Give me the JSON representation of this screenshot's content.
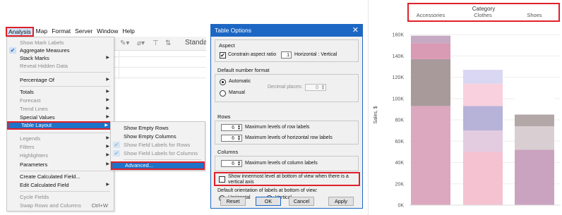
{
  "menubar": [
    "Analysis",
    "Map",
    "Format",
    "Server",
    "Window",
    "Help"
  ],
  "toolbar": {
    "standard_label": "Standa"
  },
  "analysis_menu": [
    {
      "label": "Show Mark Labels",
      "disabled": true
    },
    {
      "label": "Aggregate Measures",
      "checked": true
    },
    {
      "label": "Stack Marks",
      "submenu": true
    },
    {
      "label": "Reveal Hidden Data",
      "disabled": true
    },
    {
      "label": "Percentage Of",
      "submenu": true
    },
    {
      "label": "Totals",
      "submenu": true
    },
    {
      "label": "Forecast",
      "submenu": true,
      "disabled": true
    },
    {
      "label": "Trend Lines",
      "submenu": true,
      "disabled": true
    },
    {
      "label": "Special Values",
      "submenu": true
    },
    {
      "label": "Table Layout",
      "submenu": true,
      "highlighted": true
    },
    {
      "label": "Legends",
      "submenu": true,
      "disabled": true
    },
    {
      "label": "Filters",
      "submenu": true,
      "disabled": true
    },
    {
      "label": "Highlighters",
      "submenu": true,
      "disabled": true
    },
    {
      "label": "Parameters",
      "submenu": true
    },
    {
      "label": "Create Calculated Field..."
    },
    {
      "label": "Edit Calculated Field",
      "submenu": true
    },
    {
      "label": "Cycle Fields",
      "disabled": true
    },
    {
      "label": "Swap Rows and Columns",
      "shortcut": "Ctrl+W",
      "disabled": true
    }
  ],
  "table_layout_submenu": [
    {
      "label": "Show Empty Rows"
    },
    {
      "label": "Show Empty Columns"
    },
    {
      "label": "Show Field Labels for Rows",
      "checked": true,
      "disabled": true
    },
    {
      "label": "Show Field Labels for Columns",
      "checked": true,
      "disabled": true
    },
    {
      "label": "Advanced...",
      "highlighted": true
    }
  ],
  "dialog": {
    "title": "Table Options",
    "close_icon": "✕",
    "aspect": {
      "label": "Aspect",
      "constrain_label": "Constrain aspect ratio",
      "constrain_checked": true,
      "ratio": "1",
      "ratio_suffix": "Horizontal : Vertical"
    },
    "number_format": {
      "label": "Default number format",
      "automatic": "Automatic",
      "manual": "Manual",
      "decimal_label": "Decimal places:",
      "decimal_value": "0"
    },
    "rows": {
      "label": "Rows",
      "row_labels_value": "6",
      "row_labels_text": "Maximum levels of row labels",
      "hrow_labels_value": "6",
      "hrow_labels_text": "Maximum levels of horizontal row labels"
    },
    "columns": {
      "label": "Columns",
      "col_labels_value": "6",
      "col_labels_text": "Maximum levels of column labels",
      "innermost_text_1": "Show innermost level at bottom of view when there is a",
      "innermost_text_2": "vertical axis",
      "innermost_checked": false
    },
    "orientation": {
      "label": "Default orientation of labels at bottom of view:",
      "horizontal": "Horizontal",
      "vertical": "Vertical",
      "selected": "Horizontal"
    },
    "buttons": {
      "reset": "Reset",
      "ok": "OK",
      "cancel": "Cancel",
      "apply": "Apply"
    }
  },
  "chart_data": {
    "type": "bar",
    "stacked": true,
    "header_title": "Category",
    "categories": [
      "Accessories",
      "Clothes",
      "Shoes"
    ],
    "ylabel": "Sales, $",
    "ylim": [
      0,
      170000
    ],
    "yticks": [
      "0K",
      "20K",
      "40K",
      "60K",
      "80K",
      "100K",
      "120K",
      "140K",
      "160K"
    ],
    "grid": true,
    "series": [
      {
        "color": "#d8a4bc",
        "values": [
          93000,
          50000,
          52000
        ]
      },
      {
        "color": "#a79b9c",
        "values": [
          44000,
          20000,
          22000
        ]
      },
      {
        "color": "#d89ab2",
        "values": [
          15000,
          23000,
          11000
        ]
      },
      {
        "color": "#c8b0c0",
        "values": [
          7000,
          21000,
          21000
        ]
      },
      {
        "color": "#d9d7f2",
        "values": [
          0,
          13000,
          0
        ]
      }
    ],
    "bar_colors": [
      [
        "#dba8bf",
        "#a89a9b",
        "#d99ab4",
        "#c6a9c2",
        "#ffffff"
      ],
      [
        "#f4c2d1",
        "#e3cbe0",
        "#b7b2d8",
        "#f8d0de",
        "#d9d7f2"
      ],
      [
        "#caa3c0",
        "#d9cfd2",
        "#b3a7a8",
        "#ffffff",
        "#ffffff"
      ]
    ]
  }
}
